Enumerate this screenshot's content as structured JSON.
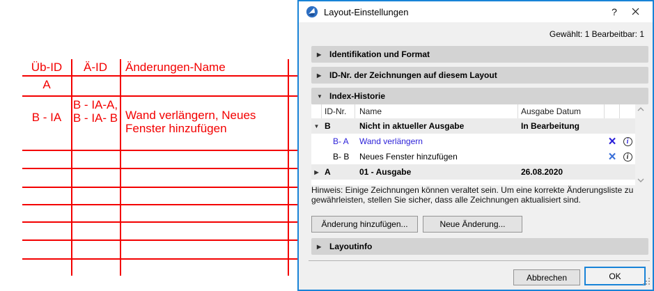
{
  "colors": {
    "drawing_red": "#f30000",
    "dialog_border_blue": "#1883d7",
    "link_blue": "#2a1fd8",
    "delete_icon_blue": "#3a6fd8"
  },
  "drawing": {
    "table": {
      "col_ueb_id": "Üb-ID",
      "col_ae_id": "Ä-ID",
      "col_name": "Änderungen-Name",
      "row_a_ueb_id": "A",
      "row_b_ueb_id": "B - IA",
      "row_b_ae_id": "B - IA-A, B - IA- B",
      "row_b_name": "Wand verlängern, Neues Fenster hinzufügen"
    }
  },
  "dialog": {
    "title": "Layout-Einstellungen",
    "help_label": "?",
    "status": "Gewählt: 1 Bearbeitbar: 1",
    "glyphs": {
      "expanded": "▼",
      "collapsed": "▶",
      "info": "i"
    },
    "panels": {
      "identification": "Identifikation und Format",
      "drawing_ids": "ID-Nr. der Zeichnungen auf diesem Layout",
      "index_history": "Index-Historie",
      "layout_info": "Layoutinfo"
    },
    "list": {
      "headers": {
        "id": "ID-Nr.",
        "name": "Name",
        "date": "Ausgabe Datum"
      },
      "rows": [
        {
          "id": "B",
          "name": "Nicht in aktueller Ausgabe",
          "date": "In Bearbeitung"
        },
        {
          "id": "B- A",
          "name": "Wand verlängern",
          "date": ""
        },
        {
          "id": "B- B",
          "name": "Neues Fenster hinzufügen",
          "date": ""
        },
        {
          "id": "A",
          "name": "01 - Ausgabe",
          "date": "26.08.2020"
        }
      ]
    },
    "hint": "Hinweis: Einige Zeichnungen können veraltet sein. Um eine korrekte Änderungsliste zu gewährleisten, stellen Sie sicher, dass alle Zeichnungen aktualisiert sind.",
    "buttons": {
      "add_change": "Änderung hinzufügen...",
      "new_change": "Neue Änderung...",
      "cancel": "Abbrechen",
      "ok": "OK"
    }
  }
}
